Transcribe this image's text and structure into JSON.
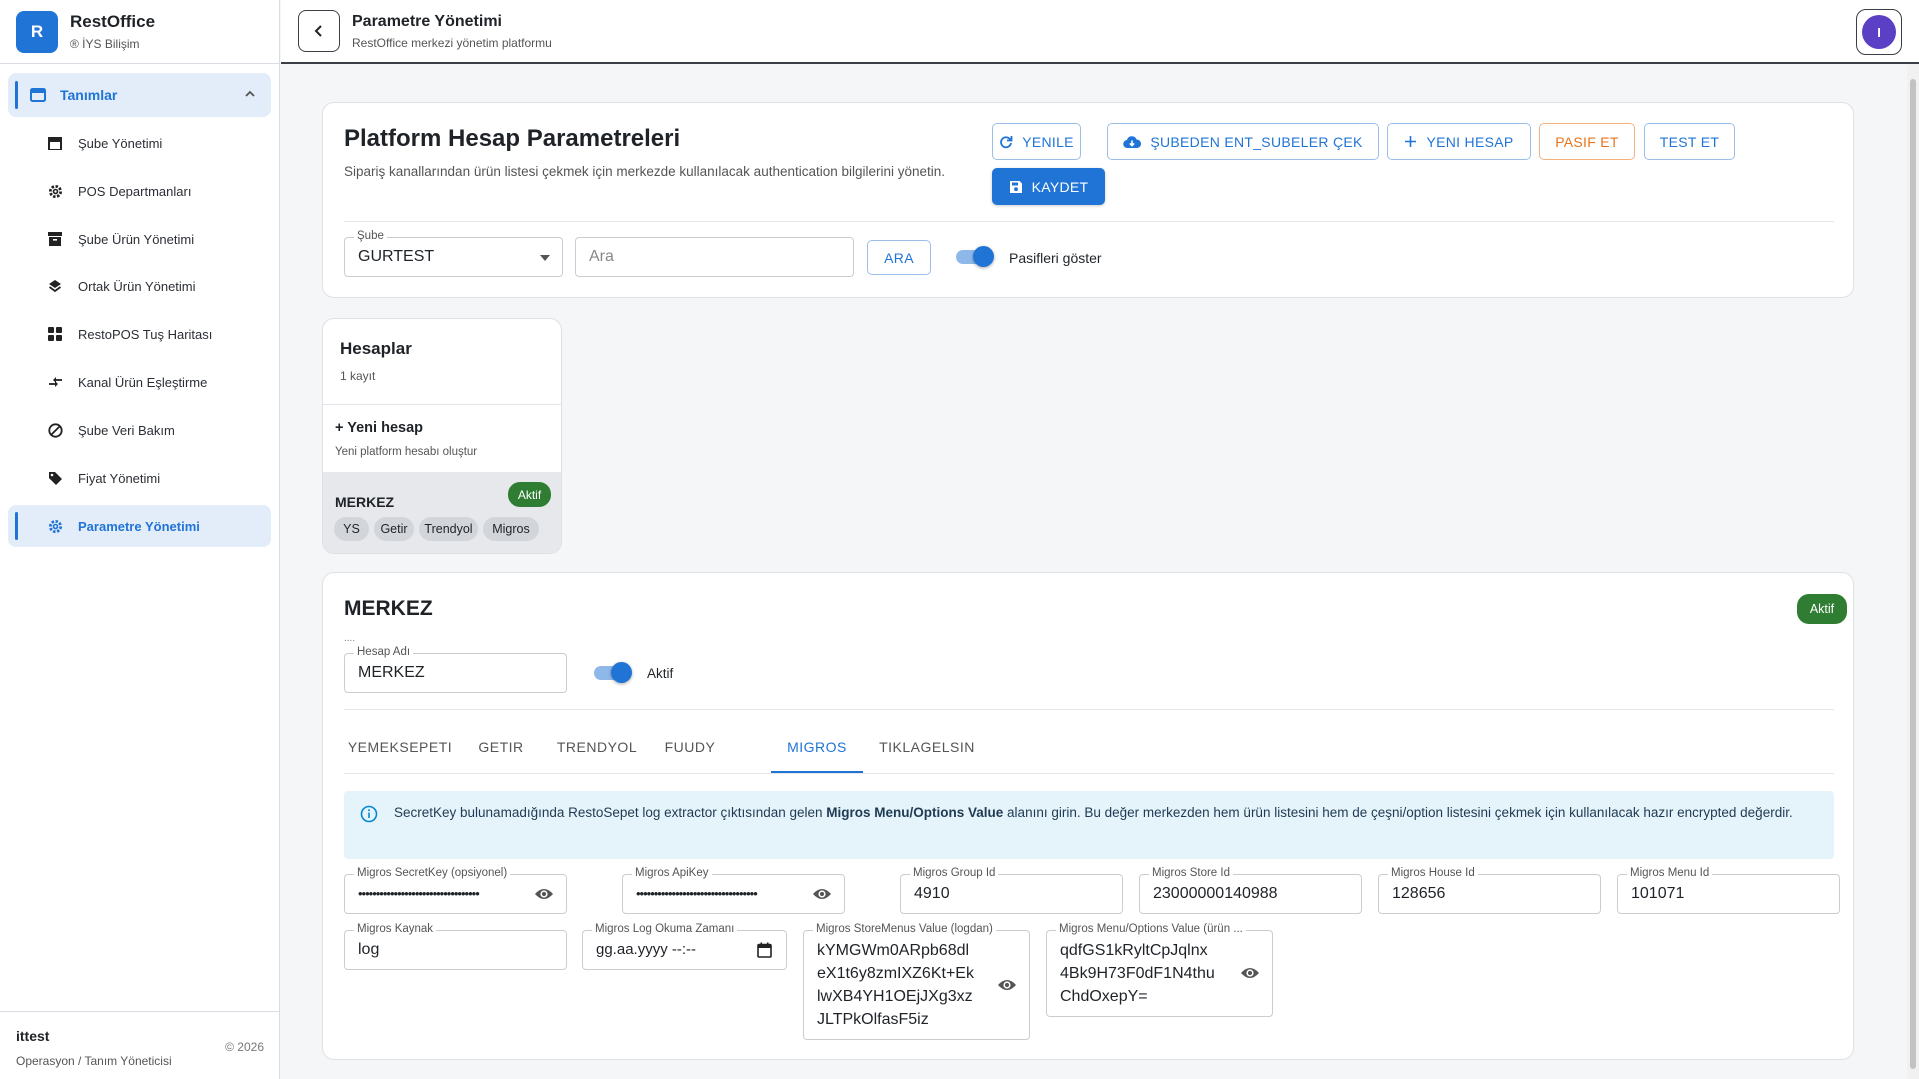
{
  "sidebar": {
    "brand_letter": "R",
    "brand_title": "RestOffice",
    "brand_sub": "® İYS Bilişim",
    "group_label": "Tanımlar",
    "items": [
      {
        "label": "Şube Yönetimi",
        "icon": "store-icon"
      },
      {
        "label": "POS Departmanları",
        "icon": "gear-icon"
      },
      {
        "label": "Şube Ürün Yönetimi",
        "icon": "archive-icon"
      },
      {
        "label": "Ortak Ürün Yönetimi",
        "icon": "layers-icon"
      },
      {
        "label": "RestoPOS Tuş Haritası",
        "icon": "grid-icon"
      },
      {
        "label": "Kanal Ürün Eşleştirme",
        "icon": "compare-arrows-icon"
      },
      {
        "label": "Şube Veri Bakım",
        "icon": "block-icon"
      },
      {
        "label": "Fiyat Yönetimi",
        "icon": "tag-icon"
      },
      {
        "label": "Parametre Yönetimi",
        "icon": "gear-icon"
      }
    ],
    "footer": {
      "user": "ittest",
      "role": "Operasyon / Tanım Yöneticisi",
      "copyright": "© 2026"
    }
  },
  "header": {
    "title": "Parametre Yönetimi",
    "subtitle": "RestOffice merkezi yönetim platformu",
    "avatar_letter": "I"
  },
  "top": {
    "title": "Platform Hesap Parametreleri",
    "description": "Sipariş kanallarından ürün listesi çekmek için merkezde kullanılacak authentication bilgilerini yönetin.",
    "buttons": {
      "refresh": "YENILE",
      "pull": "ŞUBEDEN ENT_SUBELER ÇEK",
      "new": "YENI HESAP",
      "deactivate": "PASIF ET",
      "test": "TEST ET",
      "save": "KAYDET"
    },
    "branch_label": "Şube",
    "branch_value": "GURTEST",
    "search_placeholder": "Ara",
    "search_button": "ARA",
    "show_passive_label": "Pasifleri göster",
    "show_passive": true
  },
  "accounts": {
    "title": "Hesaplar",
    "count": "1 kayıt",
    "new_title": "+ Yeni hesap",
    "new_sub": "Yeni platform hesabı oluştur",
    "items": [
      {
        "name": "MERKEZ",
        "status": "Aktif",
        "chips": [
          "YS",
          "Getir",
          "Trendyol",
          "Migros"
        ]
      }
    ]
  },
  "detail": {
    "title": "MERKEZ",
    "status": "Aktif",
    "dots": "....",
    "account_name_label": "Hesap Adı",
    "account_name": "MERKEZ",
    "active_label": "Aktif",
    "active": true,
    "tabs": [
      "YEMEKSEPETI",
      "GETIR",
      "TRENDYOL",
      "FUUDY",
      "MIGROS",
      "TIKLAGELSIN"
    ],
    "active_tab": "MIGROS",
    "info_pre": "SecretKey bulunamadığında RestoSepet log extractor çıktısından gelen ",
    "info_bold": "Migros Menu/Options Value",
    "info_post": " alanını girin. Bu değer merkezden hem ürün listesini hem de çeşni/option listesini çekmek için kullanılacak hazır encrypted değerdir.",
    "fields": {
      "secret_key": {
        "label": "Migros SecretKey (opsiyonel)",
        "value": "••••••••••••••••••••••••••••••••••"
      },
      "api_key": {
        "label": "Migros ApiKey",
        "value": "••••••••••••••••••••••••••••••••••"
      },
      "group_id": {
        "label": "Migros Group Id",
        "value": "4910"
      },
      "store_id": {
        "label": "Migros Store Id",
        "value": "23000000140988"
      },
      "house_id": {
        "label": "Migros House Id",
        "value": "128656"
      },
      "menu_id": {
        "label": "Migros Menu Id",
        "value": "101071"
      },
      "source": {
        "label": "Migros Kaynak",
        "value": "log"
      },
      "log_time": {
        "label": "Migros Log Okuma Zamanı",
        "value": "gg.aa.yyyy --:--"
      },
      "store_menus": {
        "label": "Migros StoreMenus Value (logdan)",
        "lines": [
          "kYMGWm0ARpb68dl",
          "eX1t6y8zmIXZ6Kt+Ek",
          "lwXB4YH1OEjJXg3xz",
          "JLTPkOlfasF5iz"
        ]
      },
      "menu_options": {
        "label": "Migros Menu/Options Value (ürün ...",
        "lines": [
          "qdfGS1kRyltCpJqlnx",
          "4Bk9H73F0dF1N4thu",
          "ChdOxepY="
        ]
      }
    }
  },
  "colors": {
    "accent": "#1f74d6",
    "success": "#2e7d32",
    "warning": "#e8731d",
    "info_bg": "#e5f4fb"
  }
}
